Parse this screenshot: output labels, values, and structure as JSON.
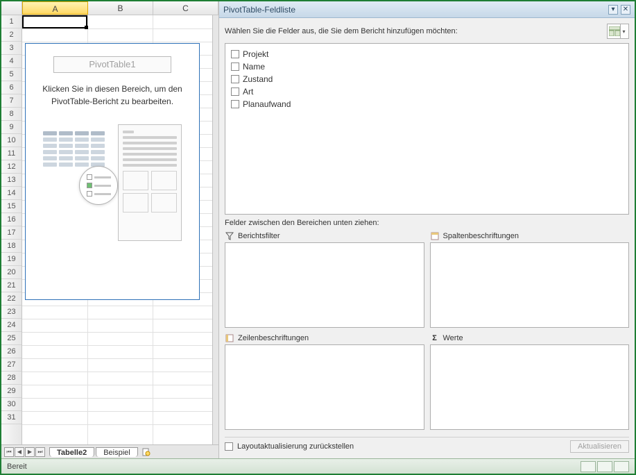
{
  "columns": [
    "A",
    "B",
    "C"
  ],
  "active_column_index": 0,
  "rows": [
    1,
    2,
    3,
    4,
    5,
    6,
    7,
    8,
    9,
    10,
    11,
    12,
    13,
    14,
    15,
    16,
    17,
    18,
    19,
    20,
    21,
    22,
    23,
    24,
    25,
    26,
    27,
    28,
    29,
    30,
    31
  ],
  "pivot_placeholder": {
    "title": "PivotTable1",
    "message": "Klicken Sie in diesen Bereich, um den PivotTable-Bericht zu bearbeiten."
  },
  "sheet_tabs": {
    "items": [
      {
        "label": "Tabelle2",
        "active": true
      },
      {
        "label": "Beispiel",
        "active": false
      }
    ]
  },
  "status": {
    "ready": "Bereit"
  },
  "panel": {
    "title": "PivotTable-Feldliste",
    "prompt": "Wählen Sie die Felder aus, die Sie dem Bericht hinzufügen möchten:",
    "fields": [
      "Projekt",
      "Name",
      "Zustand",
      "Art",
      "Planaufwand"
    ],
    "areas_prompt": "Felder zwischen den Bereichen unten ziehen:",
    "zones": {
      "report_filter": "Berichtsfilter",
      "column_labels": "Spaltenbeschriftungen",
      "row_labels": "Zeilenbeschriftungen",
      "values": "Werte"
    },
    "defer_layout": "Layoutaktualisierung zurückstellen",
    "update_button": "Aktualisieren"
  }
}
